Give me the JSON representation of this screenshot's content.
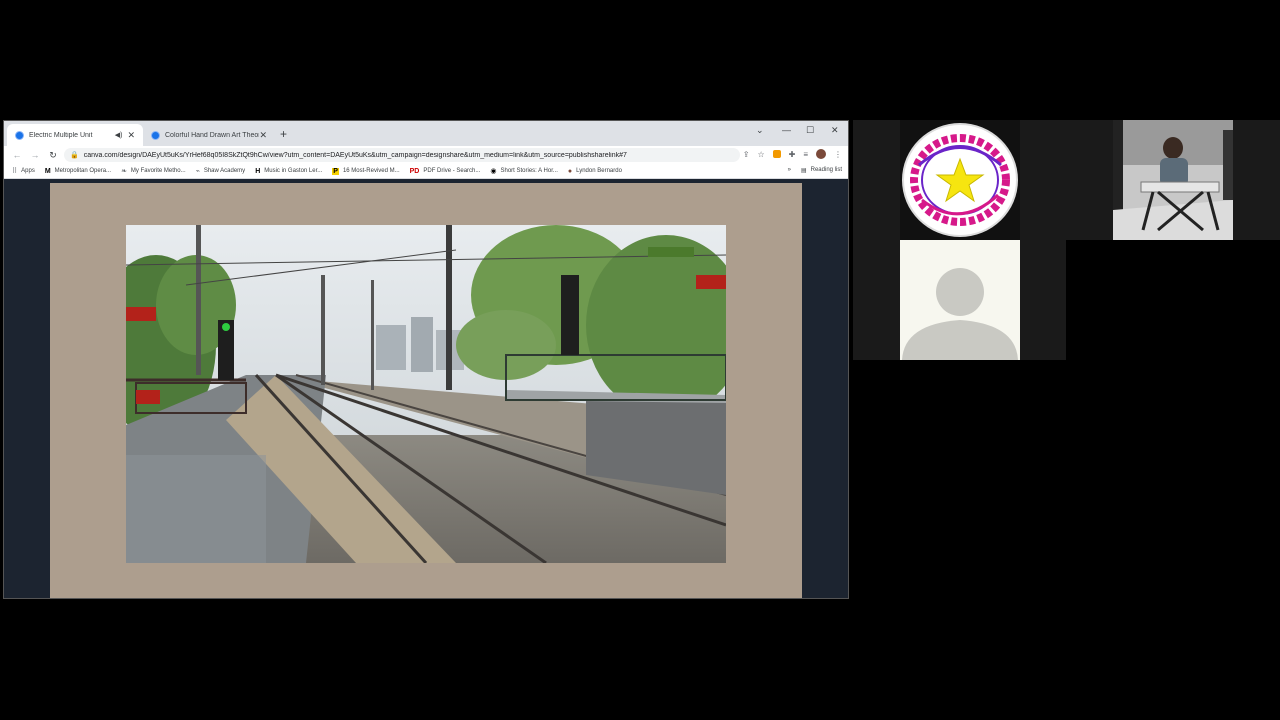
{
  "browser": {
    "tabs": [
      {
        "title": "Electric Multiple Unit",
        "active": true
      },
      {
        "title": "Colorful Hand Drawn Art Theory",
        "active": false
      }
    ],
    "new_tab_label": "+",
    "url": "canva.com/design/DAEyUt5uKs/YrHef68q05I8SkZtQt9hCw/view?utm_content=DAEyUt5uKs&utm_campaign=designshare&utm_medium=link&utm_source=publishsharelink#7",
    "bookmarks": [
      {
        "icon": "apps-icon",
        "label": "Apps"
      },
      {
        "icon": "m-icon",
        "label": "Metropolitan Opera..."
      },
      {
        "icon": "leaf-icon",
        "label": "My Favorite Metho..."
      },
      {
        "icon": "shaw-icon",
        "label": "Shaw Academy"
      },
      {
        "icon": "h-icon",
        "label": "Music in Gaston Ler..."
      },
      {
        "icon": "p-icon",
        "label": "16 Most-Revived M..."
      },
      {
        "icon": "pdf-icon",
        "label": "PDF Drive - Search..."
      },
      {
        "icon": "globe-icon",
        "label": "Short Stories: A Hor..."
      },
      {
        "icon": "avatar-icon",
        "label": "Lyndon Bernardo"
      }
    ],
    "reading_list_label": "Reading list",
    "more_bookmarks": "»"
  },
  "colors": {
    "slide_background": "#ad9e8e",
    "page_background": "#000000",
    "chrome_tabstrip": "#dee1e6"
  }
}
